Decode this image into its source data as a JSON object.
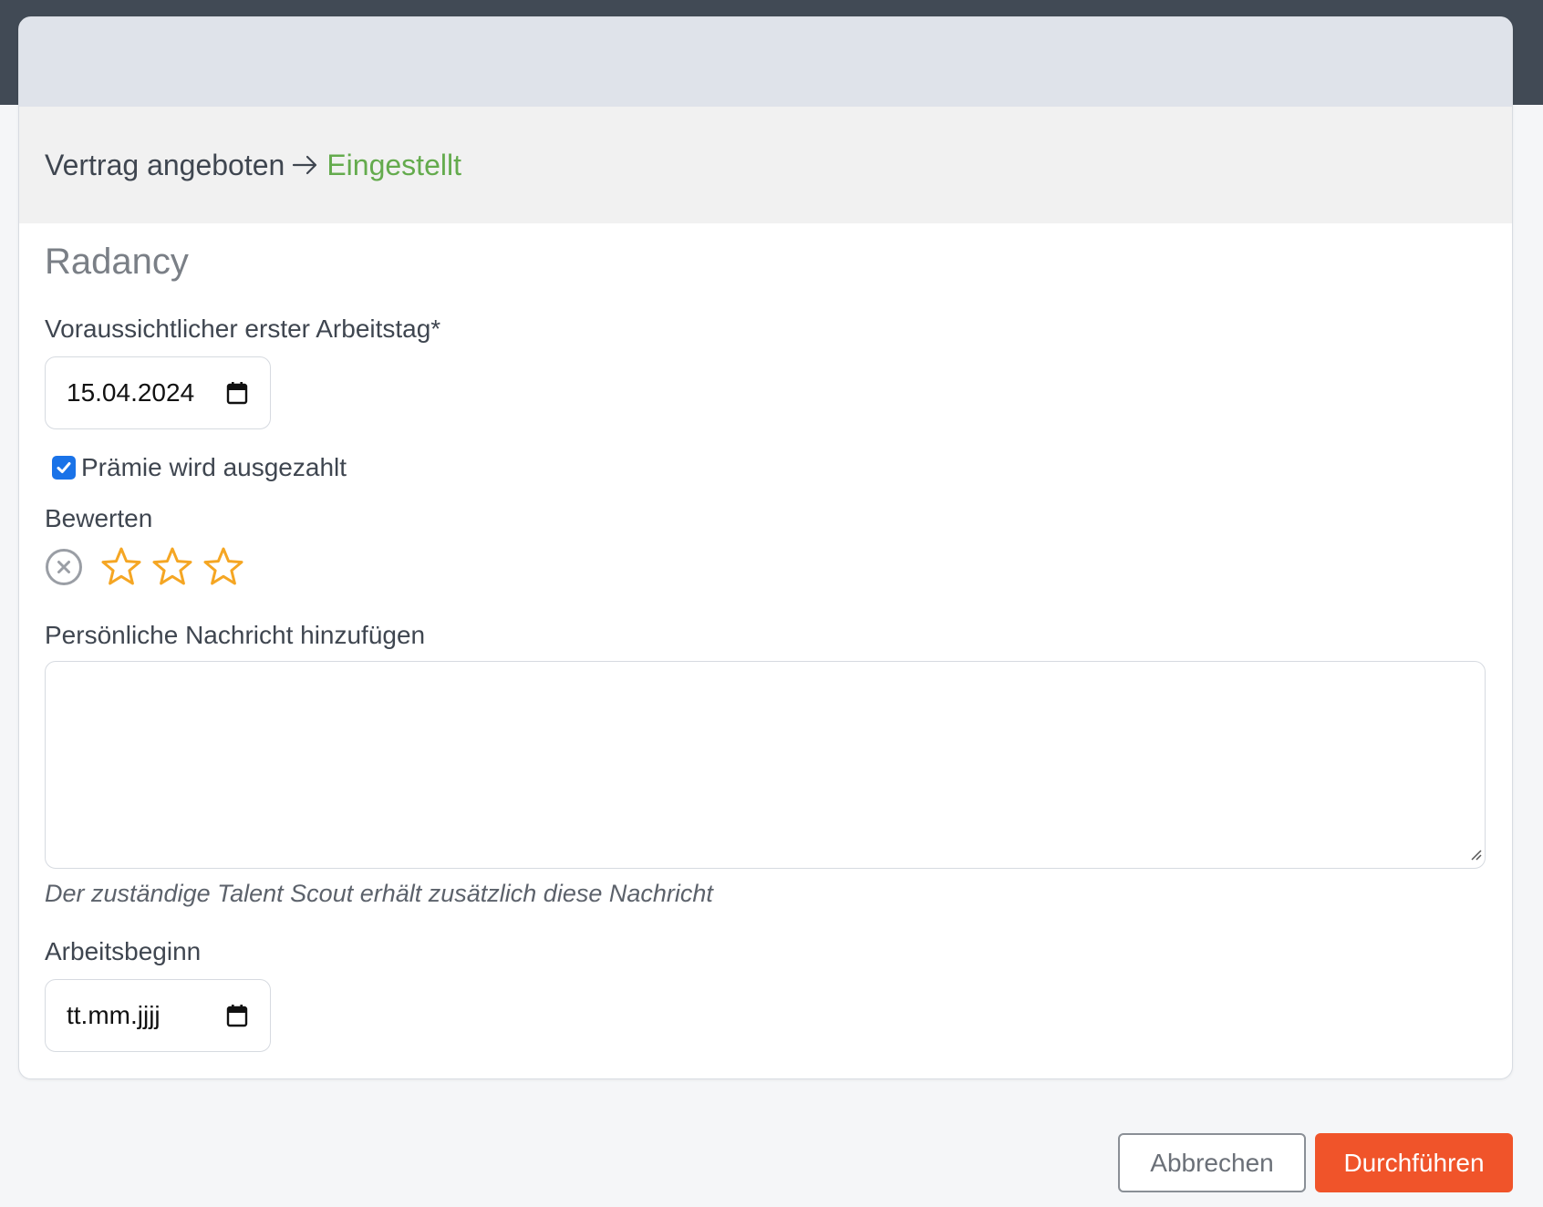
{
  "transition": {
    "from": "Vertrag angeboten",
    "to": "Eingestellt"
  },
  "company": "Radancy",
  "first_workday": {
    "label": "Voraussichtlicher erster Arbeitstag*",
    "value": "15.04.2024"
  },
  "bonus": {
    "label": "Prämie wird ausgezahlt",
    "checked": true
  },
  "rating": {
    "label": "Bewerten",
    "value": 0,
    "max": 3,
    "star_color": "#f5a623"
  },
  "message": {
    "label": "Persönliche Nachricht hinzufügen",
    "value": "",
    "hint": "Der zuständige Talent Scout erhält zusätzlich diese Nachricht"
  },
  "work_start": {
    "label": "Arbeitsbeginn",
    "placeholder": "tt.mm.jjjj"
  },
  "buttons": {
    "cancel": "Abbrechen",
    "submit": "Durchführen"
  },
  "colors": {
    "accent": "#f0542a",
    "success": "#64ab4d",
    "checkbox": "#1a73e8"
  }
}
